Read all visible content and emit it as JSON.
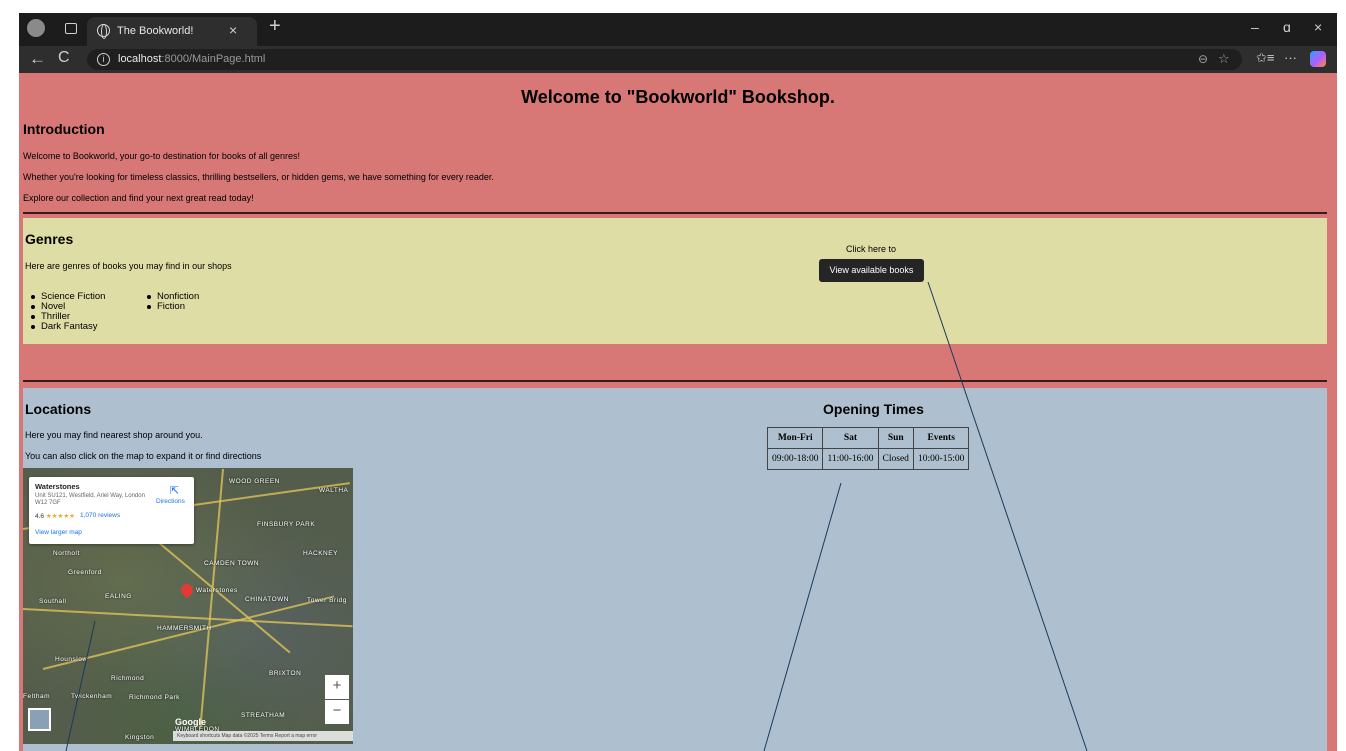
{
  "browser": {
    "tab_title": "The Bookworld!",
    "tab_close": "×",
    "new_tab": "+",
    "url_host": "localhost",
    "url_path": ":8000/MainPage.html",
    "back": "←",
    "reload": "C",
    "window_min": "–",
    "window_max": "ɑ",
    "window_close": "×",
    "more": "···"
  },
  "page": {
    "title": "Welcome to \"Bookworld\" Bookshop.",
    "intro": {
      "heading": "Introduction",
      "lines": [
        "Welcome to Bookworld, your go-to destination for books of all genres!",
        "Whether you're looking for timeless classics, thrilling bestsellers, or hidden gems, we have something for every reader.",
        "Explore our collection and find your next great read today!"
      ]
    },
    "genres": {
      "heading": "Genres",
      "text": "Here are genres of books you may find in our shops",
      "list_col1": [
        "Science Fiction",
        "Novel",
        "Thriller",
        "Dark Fantasy"
      ],
      "list_col2": [
        "Nonfiction",
        "Fiction"
      ],
      "cta_text": "Click here to",
      "cta_button": "View available books"
    },
    "locations": {
      "heading": "Locations",
      "line1": "Here you may find nearest shop around you.",
      "line2": "You can also click on the map to expand it or find directions"
    },
    "opening_times": {
      "heading": "Opening Times",
      "headers": [
        "Mon-Fri",
        "Sat",
        "Sun",
        "Events"
      ],
      "values": [
        "09:00-18:00",
        "11:00-16:00",
        "Closed",
        "10:00-15:00"
      ]
    },
    "map": {
      "place_name": "Waterstones",
      "address": "Unit SU121, Westfield, Ariel Way, London W12 7GF",
      "rating": "4.6",
      "stars": "★★★★★",
      "reviews": "1,070 reviews",
      "view_larger": "View larger map",
      "directions": "Directions",
      "labels": [
        "WOOD GREEN",
        "WALTHA",
        "FINSBURY PARK",
        "Northolt",
        "HACKNEY",
        "CAMDEN TOWN",
        "Greenford",
        "EALING",
        "Waterstones",
        "CHINATOWN",
        "Tower Bridg",
        "Southall",
        "HAMMERSMITH",
        "Hounslow",
        "Richmond",
        "BRIXTON",
        "Feltham",
        "Twickenham",
        "Richmond Park",
        "STREATHAM",
        "Kingston",
        "WIMBLEDON"
      ],
      "zoom_in": "+",
      "zoom_out": "−",
      "google": "Google",
      "attribution": "Keyboard shortcuts   Map data ©2025   Terms   Report a map error"
    }
  }
}
